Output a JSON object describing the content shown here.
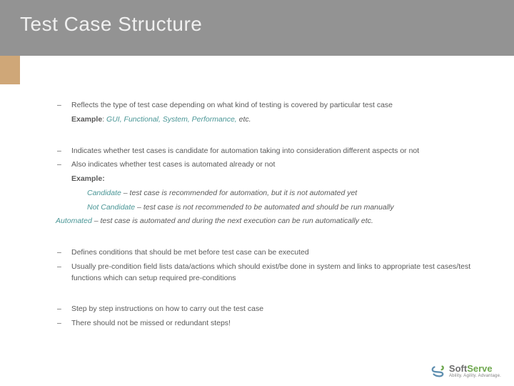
{
  "title": "Test Case Structure",
  "groups": [
    {
      "lines": [
        {
          "type": "bullet",
          "parts": [
            {
              "t": "Reflects the type of test case depending on what kind of testing is covered by particular test case"
            }
          ]
        },
        {
          "type": "indent1",
          "parts": [
            {
              "t": "Example",
              "cls": "bold"
            },
            {
              "t": ": "
            },
            {
              "t": "GUI, Functional, System, Performance,",
              "cls": "em teal"
            },
            {
              "t": " etc.",
              "cls": "em"
            }
          ]
        }
      ]
    },
    {
      "lines": [
        {
          "type": "bullet",
          "parts": [
            {
              "t": "Indicates whether test cases is candidate for automation taking into consideration different aspects or not"
            }
          ]
        },
        {
          "type": "bullet",
          "parts": [
            {
              "t": "Also indicates whether test cases is automated already or not"
            }
          ]
        },
        {
          "type": "indent1",
          "parts": [
            {
              "t": "Example:",
              "cls": "bold"
            }
          ]
        },
        {
          "type": "indent2",
          "parts": [
            {
              "t": "Candidate",
              "cls": "em teal"
            },
            {
              "t": " – test case is recommended for automation, but it is not automated yet",
              "cls": "em"
            }
          ]
        },
        {
          "type": "indent2",
          "parts": [
            {
              "t": "Not Candidate",
              "cls": "em teal"
            },
            {
              "t": " – test case is not recommended to be automated and should be run manually",
              "cls": "em"
            }
          ]
        },
        {
          "type": "noindent",
          "parts": [
            {
              "t": "Automated",
              "cls": "em teal"
            },
            {
              "t": " – test case is automated and during the next execution can be run automatically etc.",
              "cls": "em"
            }
          ]
        }
      ]
    },
    {
      "lines": [
        {
          "type": "bullet",
          "parts": [
            {
              "t": "Defines conditions that should be met before test case can be executed"
            }
          ]
        },
        {
          "type": "bullet",
          "parts": [
            {
              "t": "Usually pre-condition field lists data/actions which should exist/be done in system and links to appropriate test cases/test functions which can setup required pre-conditions"
            }
          ]
        }
      ]
    },
    {
      "lines": [
        {
          "type": "bullet",
          "parts": [
            {
              "t": "Step by step instructions on how to carry out the test case"
            }
          ]
        },
        {
          "type": "bullet",
          "parts": [
            {
              "t": "There should not be missed or redundant steps!"
            }
          ]
        }
      ]
    }
  ],
  "logo": {
    "soft": "Soft",
    "serve": "Serve",
    "tagline": "Ability. Agility. Advantage."
  }
}
